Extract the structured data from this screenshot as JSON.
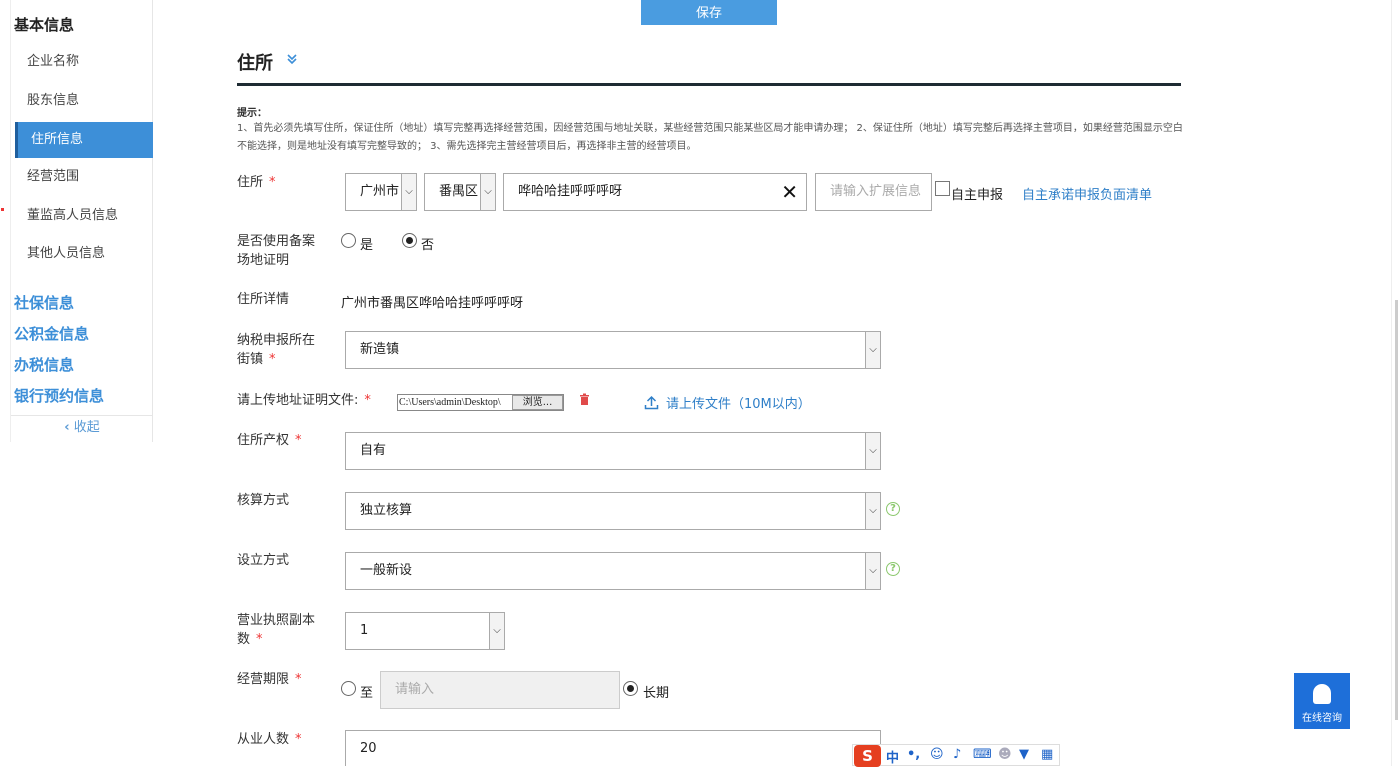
{
  "toolbar": {
    "save_label": "保存"
  },
  "sidebar": {
    "title": "基本信息",
    "items": [
      {
        "label": "企业名称"
      },
      {
        "label": "股东信息"
      },
      {
        "label": "住所信息"
      },
      {
        "label": "经营范围"
      },
      {
        "label": "董监高人员信息"
      },
      {
        "label": "其他人员信息"
      }
    ],
    "groups": [
      {
        "label": "社保信息"
      },
      {
        "label": "公积金信息"
      },
      {
        "label": "办税信息"
      },
      {
        "label": "银行预约信息"
      }
    ],
    "collapse_label": "收起"
  },
  "section": {
    "title": "住所",
    "tip_title": "提示：",
    "tip_text": "1、首先必须先填写住所，保证住所（地址）填写完整再选择经营范围，因经营范围与地址关联，某些经营范围只能某些区局才能申请办理； 2、保证住所（地址）填写完整后再选择主营项目，如果经营范围显示空白不能选择，则是地址没有填写完整导致的； 3、需先选择完主营经营项目后，再选择非主营的经营项目。"
  },
  "form": {
    "address": {
      "label": "住所",
      "required": "*",
      "city": "广州市",
      "district": "番禺区",
      "detail_value": "哗哈哈挂呼呼呼呀",
      "ext_placeholder": "请输入扩展信息",
      "self_declare_label": "自主申报",
      "commitment_link": "自主承诺申报负面清单"
    },
    "use_record_proof": {
      "label": "是否使用备案场地证明",
      "yes": "是",
      "no": "否",
      "selected": "否"
    },
    "address_detail": {
      "label": "住所详情",
      "value": "广州市番禺区哗哈哈挂呼呼呼呀"
    },
    "tax_street": {
      "label": "纳税申报所在街镇",
      "required": "*",
      "value": "新造镇"
    },
    "upload": {
      "label": "请上传地址证明文件:",
      "required": "*",
      "file_path": "C:\\Users\\admin\\Desktop\\",
      "browse_label": "浏览...",
      "upload_link": "请上传文件（10M以内）"
    },
    "property_right": {
      "label": "住所产权",
      "required": "*",
      "value": "自有"
    },
    "accounting": {
      "label": "核算方式",
      "value": "独立核算"
    },
    "establish": {
      "label": "设立方式",
      "value": "一般新设"
    },
    "license_copies": {
      "label": "营业执照副本数",
      "required": "*",
      "value": "1"
    },
    "business_term": {
      "label": "经营期限",
      "required": "*",
      "to_label": "至",
      "to_placeholder": "请输入",
      "long_label": "长期",
      "selected": "长期"
    },
    "employees": {
      "label": "从业人数",
      "required": "*",
      "value": "20"
    }
  },
  "consult": {
    "label": "在线咨询"
  },
  "ime": {
    "lang": "中",
    "punct": "•,"
  }
}
